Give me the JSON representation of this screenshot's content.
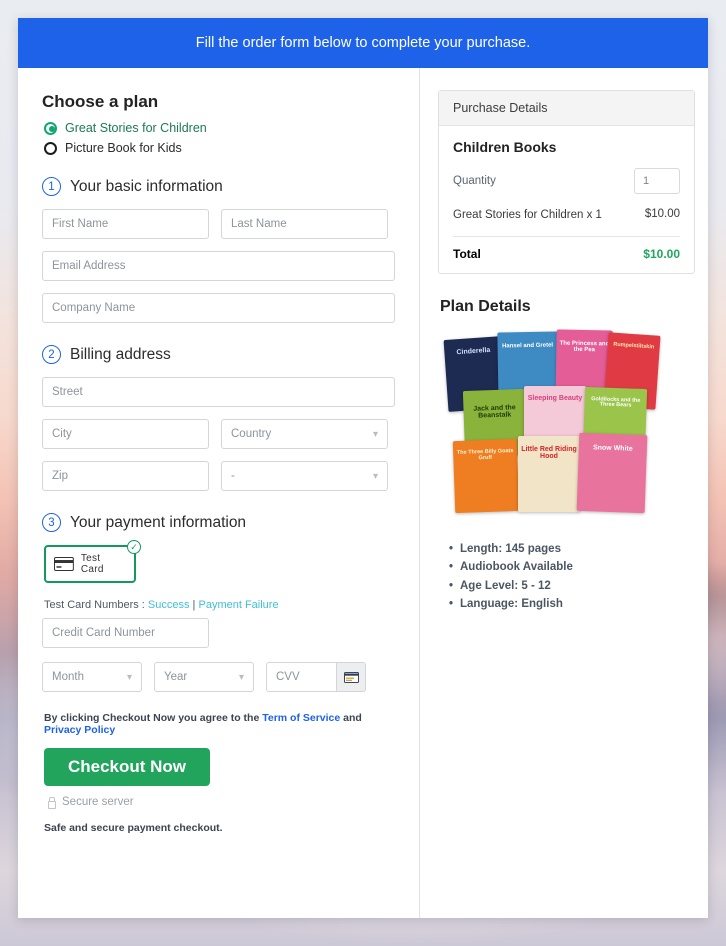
{
  "banner": {
    "text": "Fill the order form below to complete your purchase."
  },
  "plan": {
    "heading": "Choose a plan",
    "options": [
      {
        "label": "Great Stories for Children",
        "selected": true
      },
      {
        "label": "Picture Book for Kids",
        "selected": false
      }
    ]
  },
  "steps": {
    "basic": {
      "number": "1",
      "title": "Your basic information"
    },
    "billing": {
      "number": "2",
      "title": "Billing address"
    },
    "payment": {
      "number": "3",
      "title": "Your payment information"
    }
  },
  "fields": {
    "first_name": "First Name",
    "last_name": "Last Name",
    "email": "Email Address",
    "company": "Company Name",
    "street": "Street",
    "city": "City",
    "country": "Country",
    "zip": "Zip",
    "state": "-",
    "credit_card": "Credit Card Number",
    "month": "Month",
    "year": "Year",
    "cvv": "CVV"
  },
  "payment": {
    "test_card_label": "Test  Card",
    "check_glyph": "✓",
    "test_numbers_prefix": "Test Card Numbers : ",
    "link_success": "Success",
    "link_separator": " | ",
    "link_failure": "Payment Failure"
  },
  "agreement": {
    "prefix": "By clicking Checkout Now you agree to the ",
    "terms": "Term of Service",
    "and": " and ",
    "privacy": "Privacy Policy"
  },
  "checkout": {
    "button": "Checkout Now",
    "secure_server": "Secure server",
    "safe_note": "Safe and secure payment checkout."
  },
  "purchase": {
    "header": "Purchase Details",
    "product": "Children Books",
    "quantity_label": "Quantity",
    "quantity_value": "1",
    "line_item": "Great Stories for Children x 1",
    "line_amount": "$10.00",
    "total_label": "Total",
    "total_amount": "$10.00"
  },
  "plan_details": {
    "title": "Plan Details",
    "bullets": [
      "Length: 145 pages",
      "Audiobook Available",
      "Age Level: 5 - 12",
      "Language: English"
    ],
    "book_covers": [
      {
        "title": "Cinderella",
        "bg": "#1d2a52",
        "fg": "#cfe0ff"
      },
      {
        "title": "Hansel and Gretel",
        "bg": "#3e8bc4",
        "fg": "#ffffff"
      },
      {
        "title": "The Princess and the Pea",
        "bg": "#e45d97",
        "fg": "#ffffff"
      },
      {
        "title": "Rumpelstiltskin",
        "bg": "#e03b45",
        "fg": "#ffe9a8"
      },
      {
        "title": "Jack and the Beanstalk",
        "bg": "#8ab33b",
        "fg": "#1d3b0a"
      },
      {
        "title": "Sleeping Beauty",
        "bg": "#f4c9d8",
        "fg": "#d8407c"
      },
      {
        "title": "Goldilocks and the Three Bears",
        "bg": "#9ac44a",
        "fg": "#ffffff"
      },
      {
        "title": "The Three Billy Goats Gruff",
        "bg": "#ef7d22",
        "fg": "#fff4d0"
      },
      {
        "title": "Little Red Riding Hood",
        "bg": "#f2e4c6",
        "fg": "#d3252b"
      },
      {
        "title": "Snow White",
        "bg": "#e8739c",
        "fg": "#ffffff"
      }
    ]
  },
  "colors": {
    "banner_blue": "#1d62e8",
    "accent_green": "#22a45d",
    "link_cyan": "#3fc0d8",
    "link_blue": "#1d62e8",
    "total_green": "#1fa85c"
  }
}
